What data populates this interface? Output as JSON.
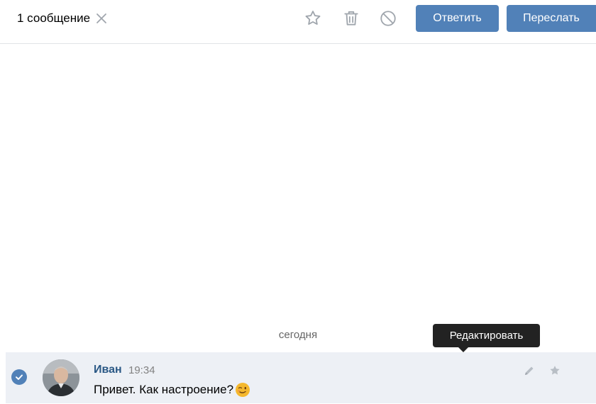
{
  "header": {
    "selection_label": "1 сообщение",
    "reply_label": "Ответить",
    "forward_label": "Переслать",
    "icons": [
      "close-icon",
      "star-outline-icon",
      "trash-icon",
      "block-icon"
    ]
  },
  "divider": {
    "date_label": "сегодня"
  },
  "tooltip": {
    "text": "Редактировать"
  },
  "message": {
    "author": "Иван",
    "time": "19:34",
    "text": "Привет. Как настроение?",
    "emoji": "winking-face",
    "selected": true,
    "actions": [
      "edit-pencil-icon",
      "favorite-star-icon"
    ]
  },
  "colors": {
    "accent": "#5181b8",
    "author_link": "#2a5885",
    "selected_row_bg": "#edf0f5",
    "tooltip_bg": "#222222",
    "muted_icon": "#a0a6ad"
  }
}
